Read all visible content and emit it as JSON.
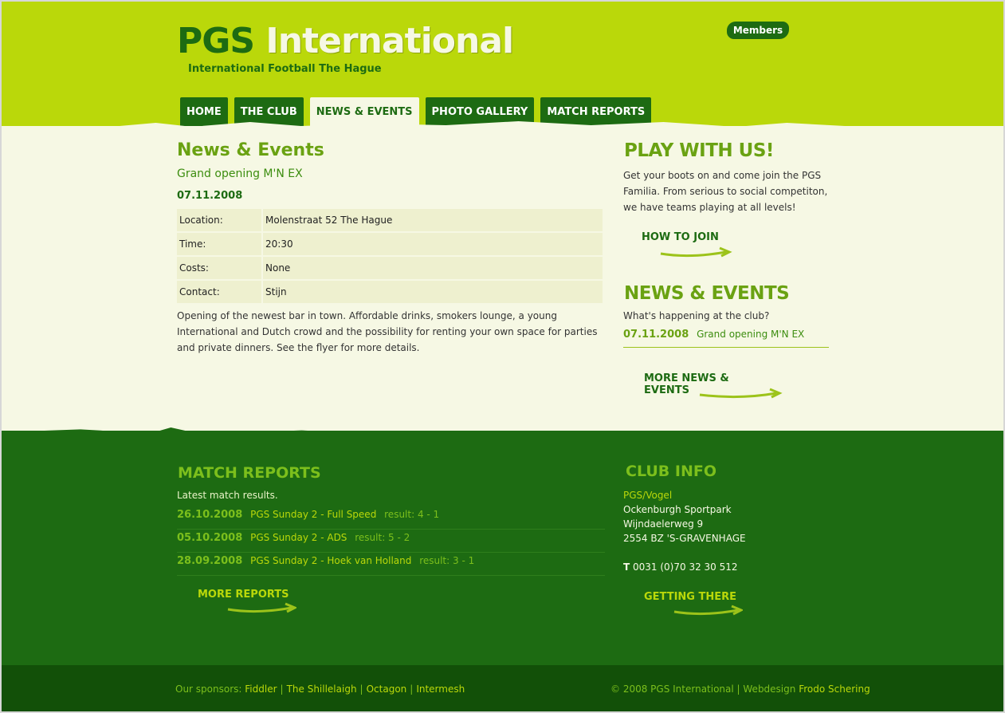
{
  "header": {
    "logo_pgs": "PGS",
    "logo_international": "International",
    "tagline": "International Football The Hague",
    "members_label": "Members"
  },
  "nav": {
    "tabs": [
      {
        "label": "HOME",
        "active": false
      },
      {
        "label": "THE CLUB",
        "active": false
      },
      {
        "label": "NEWS & EVENTS",
        "active": true
      },
      {
        "label": "PHOTO GALLERY",
        "active": false
      },
      {
        "label": "MATCH REPORTS",
        "active": false
      }
    ]
  },
  "main": {
    "title": "News & Events",
    "event_title": "Grand opening M'N EX",
    "event_date": "07.11.2008",
    "details": [
      {
        "label": "Location:",
        "value": "Molenstraat 52 The Hague"
      },
      {
        "label": "Time:",
        "value": "20:30"
      },
      {
        "label": "Costs:",
        "value": "None"
      },
      {
        "label": "Contact:",
        "value": "Stijn"
      }
    ],
    "description": "Opening of the newest bar in town. Affordable drinks, smokers lounge, a young International and Dutch crowd and the possibility for renting your own space for parties and private dinners. See the flyer for more details."
  },
  "sidebar": {
    "play_heading": "PLAY WITH US!",
    "play_text": "Get your boots on and come join the PGS Familia. From serious to social competiton, we have teams playing at all levels!",
    "how_to_join": "HOW TO JOIN",
    "news_heading": "NEWS & EVENTS",
    "news_sub": "What's happening at the club?",
    "news_item": {
      "date": "07.11.2008",
      "title": "Grand opening M'N EX"
    },
    "more_news": "MORE NEWS & EVENTS"
  },
  "footer": {
    "match_heading": "MATCH REPORTS",
    "match_sub": "Latest match results.",
    "matches": [
      {
        "date": "26.10.2008",
        "title": "PGS Sunday 2 - Full Speed",
        "result": "result: 4 - 1"
      },
      {
        "date": "05.10.2008",
        "title": "PGS Sunday 2 - ADS",
        "result": "result: 5 - 2"
      },
      {
        "date": "28.09.2008",
        "title": "PGS Sunday 2 - Hoek van Holland",
        "result": "result: 3 - 1"
      }
    ],
    "more_reports": "MORE REPORTS",
    "club_heading": "CLUB INFO",
    "club_name": "PGS/Vogel",
    "club_address": [
      "Ockenburgh Sportpark",
      "Wijndaelerweg 9",
      "2554 BZ 'S-GRAVENHAGE"
    ],
    "phone_label": "T",
    "phone": "0031 (0)70 32 30 512",
    "getting_there": "GETTING THERE",
    "sponsors_label": "Our sponsors:",
    "sponsors": [
      "Fiddler",
      "The Shillelaigh",
      "Octagon",
      "Intermesh"
    ],
    "copyright": "© 2008 PGS International | Webdesign",
    "designer": "Frodo Schering"
  },
  "colors": {
    "lime": "#bad80a",
    "dark_green": "#1d6b12",
    "cream": "#f6f8e4",
    "accent_green": "#6aa212"
  }
}
